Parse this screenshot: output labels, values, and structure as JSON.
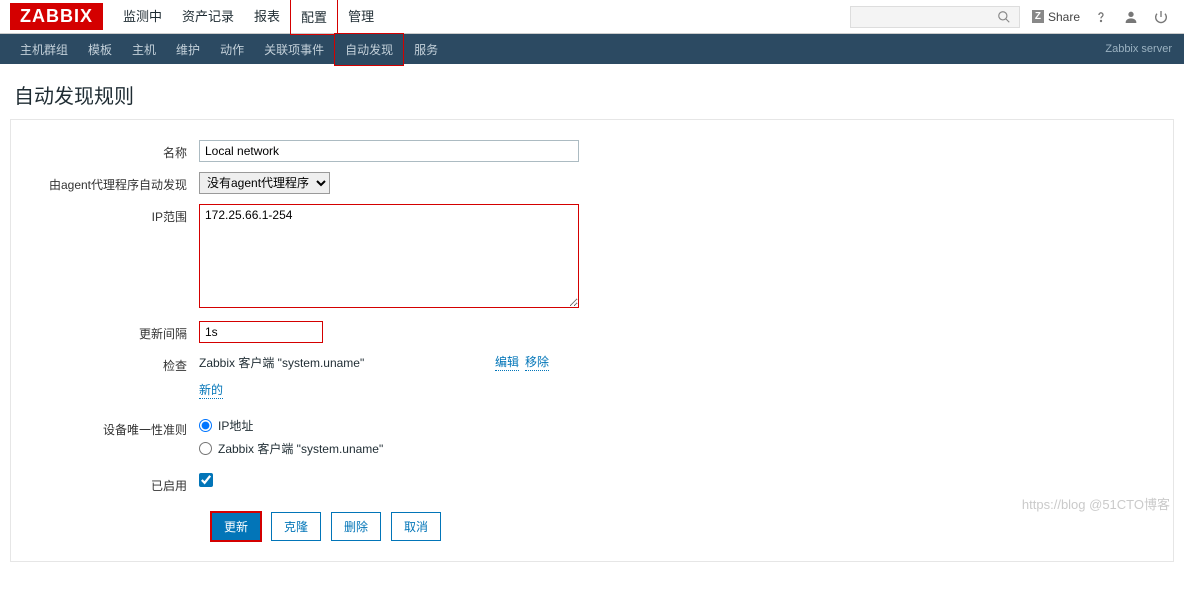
{
  "logo": "ZABBIX",
  "top_nav": {
    "items": [
      "监测中",
      "资产记录",
      "报表",
      "配置",
      "管理"
    ],
    "active_index": 3,
    "share": "Share",
    "server_label": "Zabbix server"
  },
  "sub_nav": {
    "items": [
      "主机群组",
      "模板",
      "主机",
      "维护",
      "动作",
      "关联项事件",
      "自动发现",
      "服务"
    ],
    "active_index": 6
  },
  "page_title": "自动发现规则",
  "form": {
    "name_label": "名称",
    "name_value": "Local network",
    "proxy_label": "由agent代理程序自动发现",
    "proxy_value": "没有agent代理程序",
    "iprange_label": "IP范围",
    "iprange_value": "172.25.66.1-254",
    "interval_label": "更新间隔",
    "interval_value": "1s",
    "checks_label": "检查",
    "check_item": "Zabbix 客户端 \"system.uname\"",
    "edit_link": "编辑",
    "remove_link": "移除",
    "new_link": "新的",
    "uniqueness_label": "设备唯一性准则",
    "uniqueness_options": [
      "IP地址",
      "Zabbix 客户端 \"system.uname\""
    ],
    "uniqueness_selected": 0,
    "enabled_label": "已启用",
    "enabled": true
  },
  "buttons": {
    "update": "更新",
    "clone": "克隆",
    "delete": "删除",
    "cancel": "取消"
  },
  "watermark": "https://blog @51CTO博客"
}
